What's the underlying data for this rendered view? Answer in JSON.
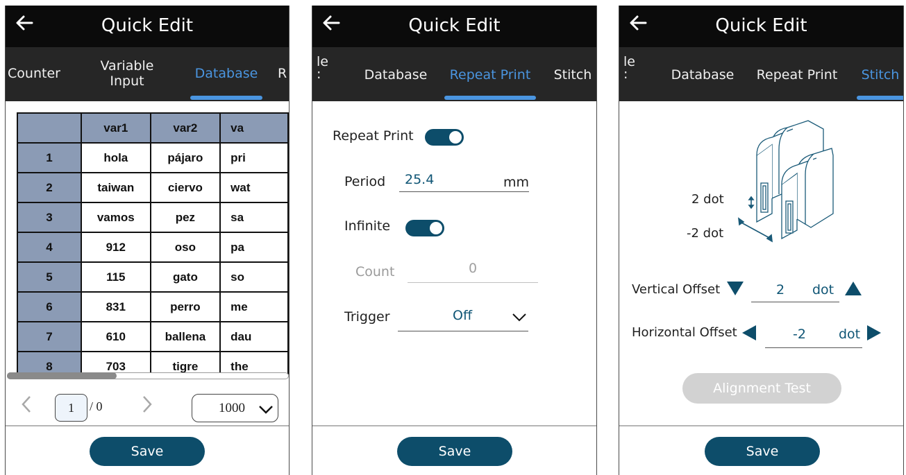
{
  "common": {
    "title": "Quick Edit",
    "save_label": "Save"
  },
  "screen1": {
    "tabs": [
      {
        "label": "Counter"
      },
      {
        "label": "Variable\nInput"
      },
      {
        "label": "Database"
      },
      {
        "label": "R"
      }
    ],
    "table": {
      "headers": [
        "",
        "var1",
        "var2",
        "va"
      ],
      "rows": [
        [
          "1",
          "hola",
          "pájaro",
          "pri"
        ],
        [
          "2",
          "taiwan",
          "ciervo",
          "wat"
        ],
        [
          "3",
          "vamos",
          "pez",
          "sa"
        ],
        [
          "4",
          "912",
          "oso",
          "pa"
        ],
        [
          "5",
          "115",
          "gato",
          "so"
        ],
        [
          "6",
          "831",
          "perro",
          "me"
        ],
        [
          "7",
          "610",
          "ballena",
          "dau"
        ],
        [
          "8",
          "703",
          "tigre",
          "the"
        ]
      ]
    },
    "pager": {
      "page": "1",
      "total": "/ 0",
      "page_size": "1000"
    }
  },
  "screen2": {
    "tabs": [
      {
        "label": "le\n:"
      },
      {
        "label": "Database"
      },
      {
        "label": "Repeat Print"
      },
      {
        "label": "Stitch"
      }
    ],
    "repeat_print_label": "Repeat Print",
    "repeat_print_on": true,
    "period_label": "Period",
    "period_value": "25.4",
    "period_unit": "mm",
    "infinite_label": "Infinite",
    "infinite_on": true,
    "count_label": "Count",
    "count_value": "0",
    "trigger_label": "Trigger",
    "trigger_value": "Off"
  },
  "screen3": {
    "tabs": [
      {
        "label": "le\n:"
      },
      {
        "label": "Database"
      },
      {
        "label": "Repeat Print"
      },
      {
        "label": "Stitch"
      }
    ],
    "diagram_vertical": "2 dot",
    "diagram_horizontal": "-2 dot",
    "vertical_label": "Vertical Offset",
    "vertical_value": "2",
    "vertical_unit": "dot",
    "horizontal_label": "Horizontal Offset",
    "horizontal_value": "-2",
    "horizontal_unit": "dot",
    "alignment_test_label": "Alignment Test"
  },
  "colors": {
    "accent_tab": "#4a95e0",
    "primary": "#0d4d6a",
    "header_cell": "#8b9bb5"
  }
}
